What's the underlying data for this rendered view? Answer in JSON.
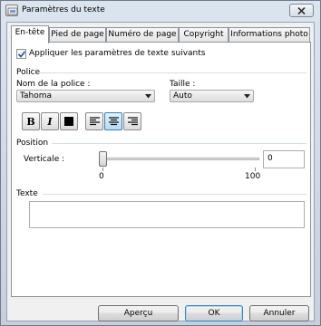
{
  "window": {
    "title": "Paramètres du texte",
    "close_label": "×"
  },
  "tabs": [
    {
      "label": "En-tête",
      "active": true
    },
    {
      "label": "Pied de page",
      "active": false
    },
    {
      "label": "Numéro de page",
      "active": false
    },
    {
      "label": "Copyright",
      "active": false
    },
    {
      "label": "Informations photo",
      "active": false
    }
  ],
  "apply": {
    "label": "Appliquer les paramètres de texte suivants",
    "checked": true
  },
  "font_group": {
    "title": "Police",
    "font_name_label": "Nom de la police :",
    "font_name_value": "Tahoma",
    "size_label": "Taille :",
    "size_value": "Auto",
    "bold_label": "B",
    "italic_label": "I",
    "align_selected": "center"
  },
  "position_group": {
    "title": "Position",
    "vertical_label": "Verticale :",
    "slider_min": "0",
    "slider_max": "100",
    "value": "0",
    "slider_level": 0
  },
  "text_group": {
    "title": "Texte",
    "value": ""
  },
  "buttons": {
    "preview": "Aperçu",
    "ok": "OK",
    "cancel": "Annuler"
  },
  "colors": {
    "accent": "#3c7fb1",
    "window_frame": "#c5d0dc"
  }
}
